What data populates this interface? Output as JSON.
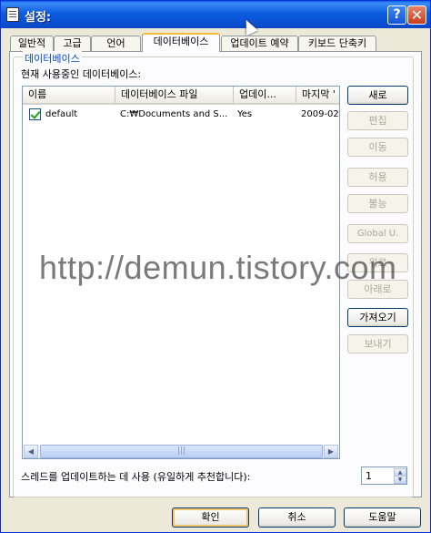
{
  "window": {
    "title": "설정:",
    "help_glyph": "?",
    "close_glyph": "✕"
  },
  "tabs": [
    {
      "label": "일반적"
    },
    {
      "label": "고급"
    },
    {
      "label": "언어"
    },
    {
      "label": "데이터베이스",
      "active": true
    },
    {
      "label": "업데이트 예약"
    },
    {
      "label": "키보드 단축키"
    }
  ],
  "group": {
    "label": "데이터베이스",
    "subtitle": "현재 사용중인 데이터베이스:"
  },
  "list": {
    "columns": [
      "이름",
      "데이터베이스 파일",
      "업데이...",
      "마지막 '"
    ],
    "rows": [
      {
        "checked": true,
        "name": "default",
        "file": "C:₩Documents and S...",
        "update": "Yes",
        "last": "2009-02-"
      }
    ],
    "scroll_left": "◀",
    "scroll_right": "▶",
    "thumb_grip": "|||"
  },
  "side_buttons": [
    {
      "label": "새로",
      "enabled": true
    },
    {
      "label": "편집",
      "enabled": false
    },
    {
      "label": "이동",
      "enabled": false
    },
    {
      "label": "허용",
      "enabled": false
    },
    {
      "label": "불능",
      "enabled": false
    },
    {
      "label": "Global U.",
      "enabled": false
    },
    {
      "label": "위로",
      "enabled": false
    },
    {
      "label": "아래로",
      "enabled": false
    },
    {
      "label": "가져오기",
      "enabled": true
    },
    {
      "label": "보내기",
      "enabled": false
    }
  ],
  "threads": {
    "label": "스레드를 업데이트하는 데 사용 (유일하게 추천합니다):",
    "value": "1",
    "up": "▲",
    "down": "▼"
  },
  "footer": {
    "ok": "확인",
    "cancel": "취소",
    "help": "도움말"
  },
  "watermark": "http://demun.tistory.com"
}
